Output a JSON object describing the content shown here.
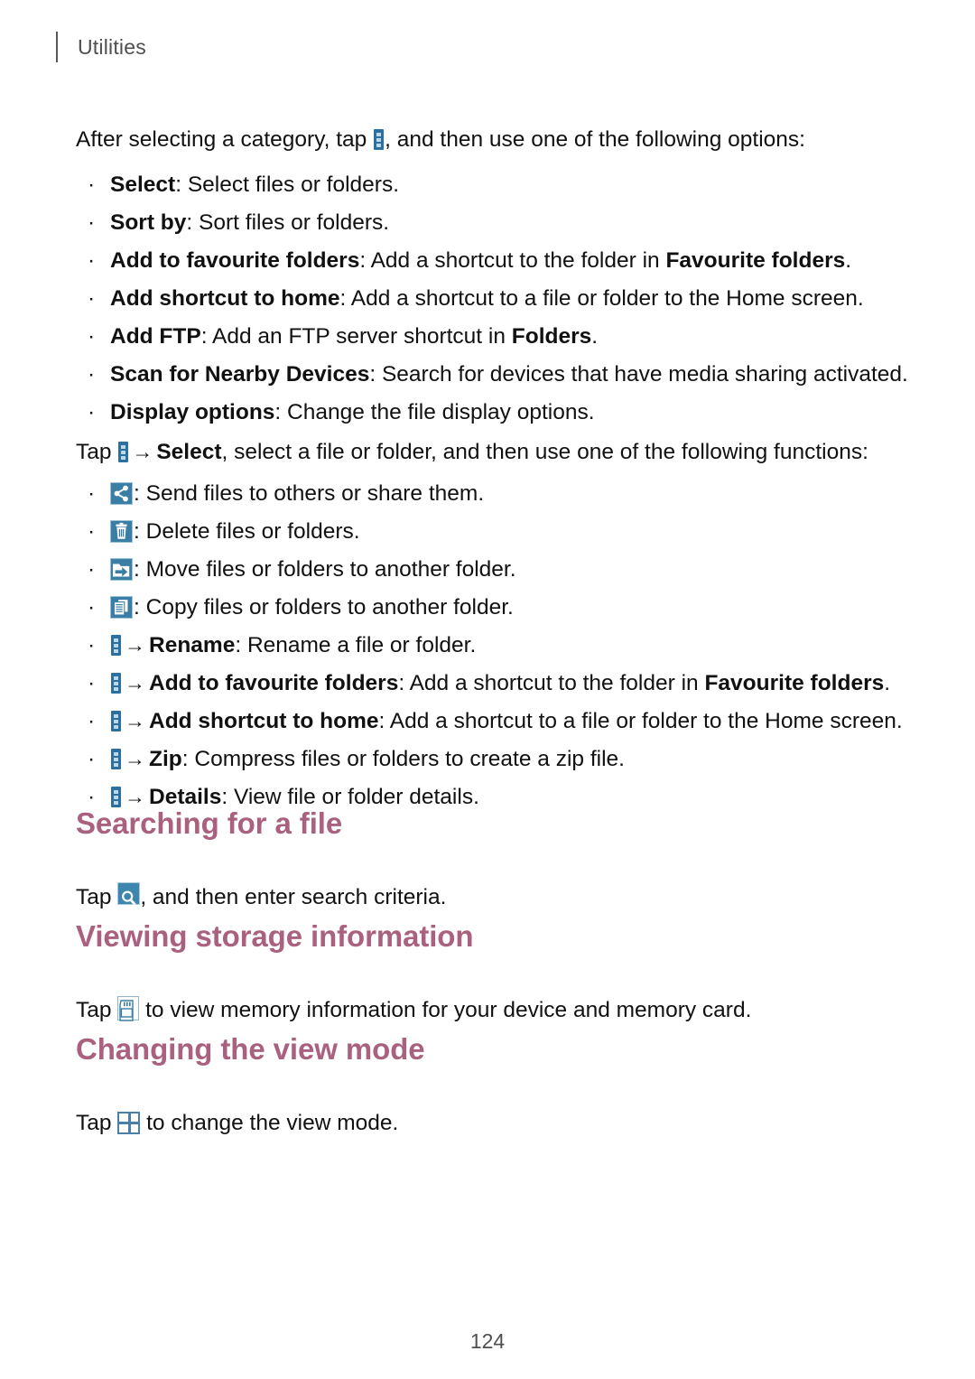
{
  "header": {
    "running_title": "Utilities"
  },
  "intro": {
    "before_icon": "After selecting a category, tap ",
    "icon": "more-options-icon",
    "after_icon": ", and then use one of the following options:"
  },
  "options_list": [
    {
      "term": "Select",
      "sep": ": ",
      "desc": "Select files or folders."
    },
    {
      "term": "Sort by",
      "sep": ": ",
      "desc": "Sort files or folders."
    },
    {
      "term": "Add to favourite folders",
      "sep": ": ",
      "desc": "Add a shortcut to the folder in ",
      "desc_bold_tail": "Favourite folders",
      "desc_end": "."
    },
    {
      "term": "Add shortcut to home",
      "sep": ": ",
      "desc": "Add a shortcut to a file or folder to the Home screen."
    },
    {
      "term": "Add FTP",
      "sep": ": ",
      "desc": "Add an FTP server shortcut in ",
      "desc_bold_tail": "Folders",
      "desc_end": "."
    },
    {
      "term": "Scan for Nearby Devices",
      "sep": ": ",
      "desc": "Search for devices that have media sharing activated."
    },
    {
      "term": "Display options",
      "sep": ": ",
      "desc": "Change the file display options."
    }
  ],
  "select_intro": {
    "tap_label": "Tap ",
    "icon": "more-options-icon",
    "arrow": "→",
    "bold_term": "Select",
    "tail": ", select a file or folder, and then use one of the following functions:"
  },
  "functions_list": [
    {
      "icon": "share-icon",
      "sep": ": ",
      "desc": "Send files to others or share them."
    },
    {
      "icon": "trash-icon",
      "sep": ": ",
      "desc": "Delete files or folders."
    },
    {
      "icon": "move-to-folder-icon",
      "sep": ": ",
      "desc": "Move files or folders to another folder."
    },
    {
      "icon": "copy-icon",
      "sep": ": ",
      "desc": "Copy files or folders to another folder."
    }
  ],
  "menu_functions_list": [
    {
      "icon": "more-options-icon",
      "arrow": "→",
      "term": "Rename",
      "sep": ": ",
      "desc": "Rename a file or folder."
    },
    {
      "icon": "more-options-icon",
      "arrow": "→",
      "term": "Add to favourite folders",
      "sep": ": ",
      "desc": "Add a shortcut to the folder in ",
      "desc_bold_tail": "Favourite folders",
      "desc_end": "."
    },
    {
      "icon": "more-options-icon",
      "arrow": "→",
      "term": "Add shortcut to home",
      "sep": ": ",
      "desc": "Add a shortcut to a file or folder to the Home screen."
    },
    {
      "icon": "more-options-icon",
      "arrow": "→",
      "term": "Zip",
      "sep": ": ",
      "desc": "Compress files or folders to create a zip file."
    },
    {
      "icon": "more-options-icon",
      "arrow": "→",
      "term": "Details",
      "sep": ": ",
      "desc": "View file or folder details."
    }
  ],
  "sections": [
    {
      "heading": "Searching for a file",
      "tap_label": "Tap ",
      "icon": "search-icon",
      "tail": ", and then enter search criteria."
    },
    {
      "heading": "Viewing storage information",
      "tap_label": "Tap ",
      "icon": "memory-card-icon",
      "tail": " to view memory information for your device and memory card."
    },
    {
      "heading": "Changing the view mode",
      "tap_label": "Tap ",
      "icon": "grid-view-icon",
      "tail": " to change the view mode."
    }
  ],
  "footer": {
    "page_number": "124"
  },
  "colors": {
    "heading": "#aa617f",
    "icon_blue": "#3b7ea5",
    "more_icon_blue": "#2d6f9e",
    "body_text": "#111111",
    "header_text": "#4f4f51"
  }
}
